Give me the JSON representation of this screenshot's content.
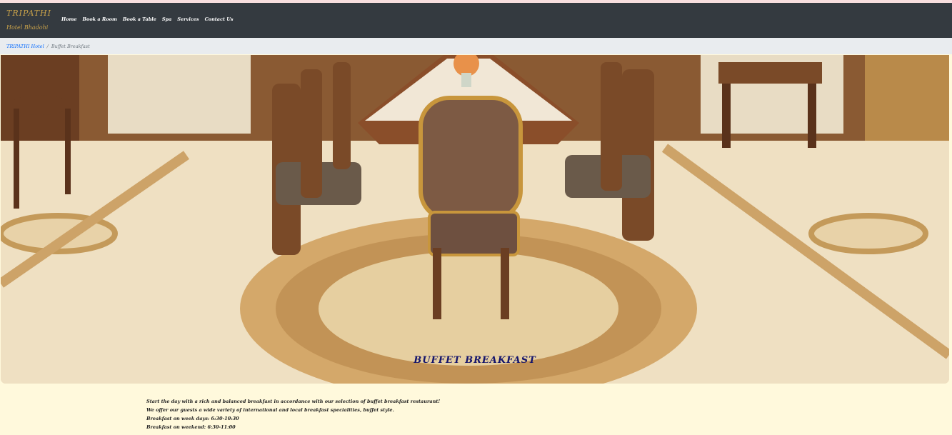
{
  "navbar": {
    "brand_title": "TRIPATHI",
    "brand_subtitle": "Hotel Bhadohi",
    "links": [
      "Home",
      "Book a Room",
      "Book a Table",
      "Spa",
      "Services",
      "Contact Us"
    ]
  },
  "breadcrumb": {
    "home": "TRIPATHI Hotel",
    "separator": "/",
    "current": "Buffet Breakfast"
  },
  "hero": {
    "caption": "BUFFET BREAKFAST"
  },
  "content": {
    "lines": [
      "Start the day with a rich and balanced breakfast in accordance with our selection of buffet breakfast restaurant!",
      "We offer our guests a wide variety of international and local breakfast specialities, buffet style.",
      "Breakfast on week days: 6:30-10:30",
      "Breakfast on weekend: 6:30-11:00"
    ]
  },
  "colors": {
    "navbar_bg": "#343a40",
    "brand": "#c9a24a",
    "breadcrumb_bg": "#e9ecef",
    "link": "#0d6efd",
    "caption": "#14146b",
    "page_bg": "#fff9dc"
  }
}
